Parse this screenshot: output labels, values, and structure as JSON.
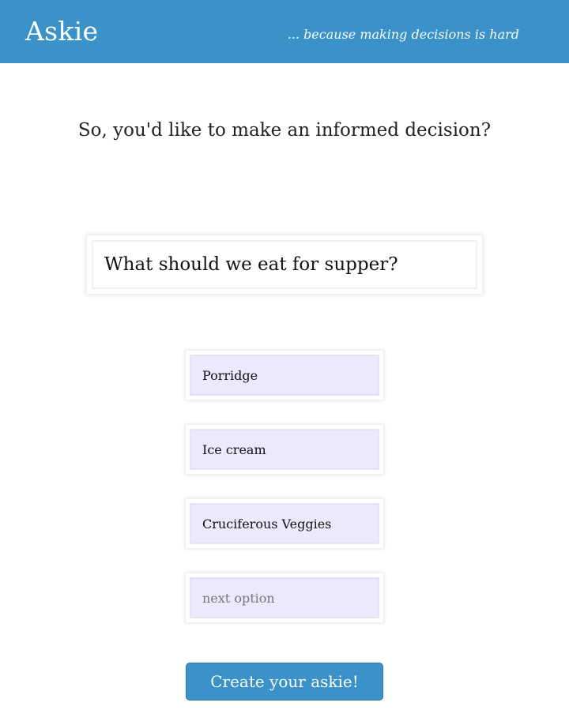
{
  "header": {
    "logo": "Askie",
    "tagline": "... because making decisions is hard"
  },
  "main": {
    "prompt": "So, you'd like to make an informed decision?",
    "question": {
      "value": "What should we eat for supper?"
    },
    "options": [
      {
        "value": "Porridge"
      },
      {
        "value": "Ice cream"
      },
      {
        "value": "Cruciferous Veggies"
      },
      {
        "value": "",
        "placeholder": "next option"
      }
    ],
    "submit_label": "Create your askie!"
  },
  "colors": {
    "brand": "#3a92c8",
    "option_background": "#ebe9fb"
  }
}
